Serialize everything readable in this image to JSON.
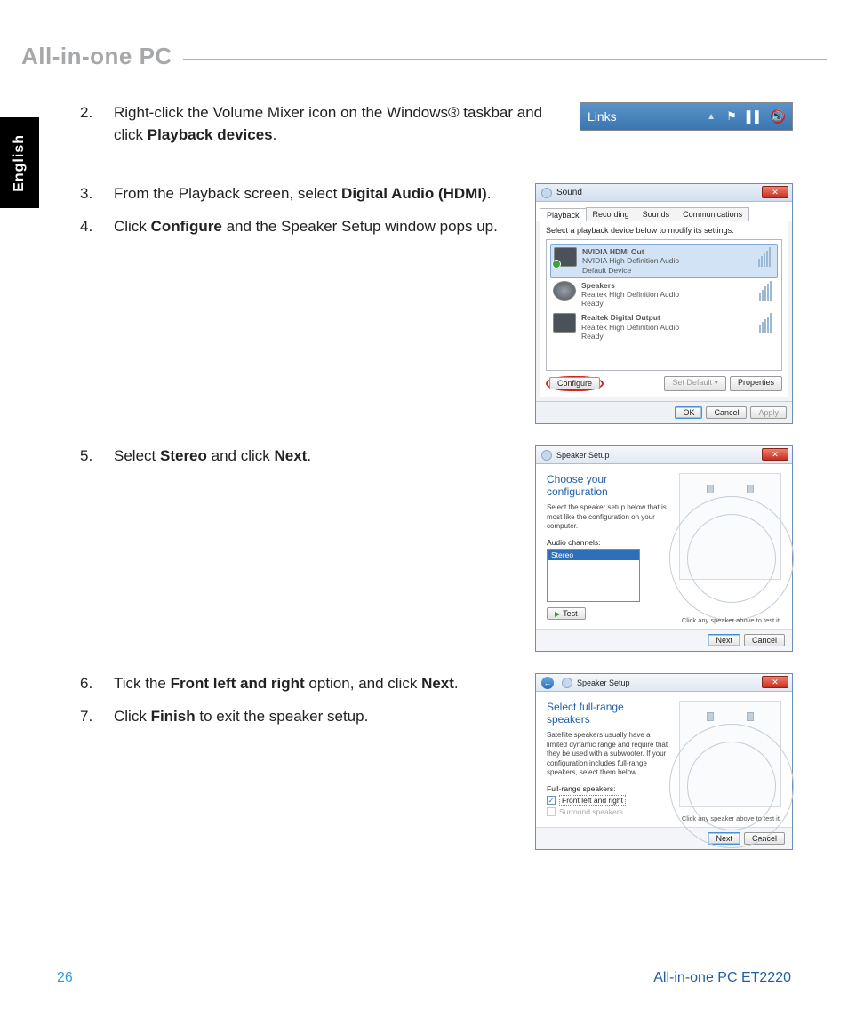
{
  "header": {
    "title": "All-in-one PC"
  },
  "side_tab": "English",
  "steps": {
    "s2": {
      "num": "2.",
      "text_a": "Right-click the Volume Mixer icon on the Windows® taskbar and click ",
      "bold": "Playback devices",
      "text_b": "."
    },
    "s3": {
      "num": "3.",
      "text_a": "From the Playback screen, select ",
      "bold": "Digital Audio (HDMI)",
      "text_b": "."
    },
    "s4": {
      "num": "4.",
      "text_a": "Click ",
      "bold": "Configure",
      "text_b": " and the Speaker Setup window pops up."
    },
    "s5": {
      "num": "5.",
      "text_a": "Select ",
      "bold1": "Stereo",
      "mid": " and click ",
      "bold2": "Next",
      "text_b": "."
    },
    "s6": {
      "num": "6.",
      "text_a": "Tick the ",
      "bold1": "Front left and right",
      "mid": " option, and click ",
      "bold2": "Next",
      "text_b": "."
    },
    "s7": {
      "num": "7.",
      "text_a": "Click ",
      "bold": "Finish",
      "text_b": " to exit the speaker setup."
    }
  },
  "taskbar": {
    "links": "Links"
  },
  "sound_dialog": {
    "title": "Sound",
    "tabs": [
      "Playback",
      "Recording",
      "Sounds",
      "Communications"
    ],
    "hint": "Select a playback device below to modify its settings:",
    "devices": [
      {
        "name": "NVIDIA HDMI Out",
        "driver": "NVIDIA High Definition Audio",
        "status": "Default Device",
        "default": true
      },
      {
        "name": "Speakers",
        "driver": "Realtek High Definition Audio",
        "status": "Ready"
      },
      {
        "name": "Realtek Digital Output",
        "driver": "Realtek High Definition Audio",
        "status": "Ready"
      }
    ],
    "btn_configure": "Configure",
    "btn_setdefault": "Set Default",
    "btn_properties": "Properties",
    "btn_ok": "OK",
    "btn_cancel": "Cancel",
    "btn_apply": "Apply"
  },
  "speaker_setup1": {
    "title": "Speaker Setup",
    "heading": "Choose your configuration",
    "desc": "Select the speaker setup below that is most like the configuration on your computer.",
    "label_channels": "Audio channels:",
    "option": "Stereo",
    "btn_test": "Test",
    "hint_right": "Click any speaker above to test it.",
    "btn_next": "Next",
    "btn_cancel": "Cancel"
  },
  "speaker_setup2": {
    "title": "Speaker Setup",
    "heading": "Select full-range speakers",
    "desc": "Satellite speakers usually have a limited dynamic range and require that they be used with a subwoofer. If your configuration includes full-range speakers, select them below.",
    "label_fullrange": "Full-range speakers:",
    "opt_front": "Front left and right",
    "opt_surround": "Surround speakers",
    "hint_right": "Click any speaker above to test it.",
    "btn_next": "Next",
    "btn_cancel": "Cancel"
  },
  "footer": {
    "page": "26",
    "product": "All-in-one PC ET2220"
  }
}
